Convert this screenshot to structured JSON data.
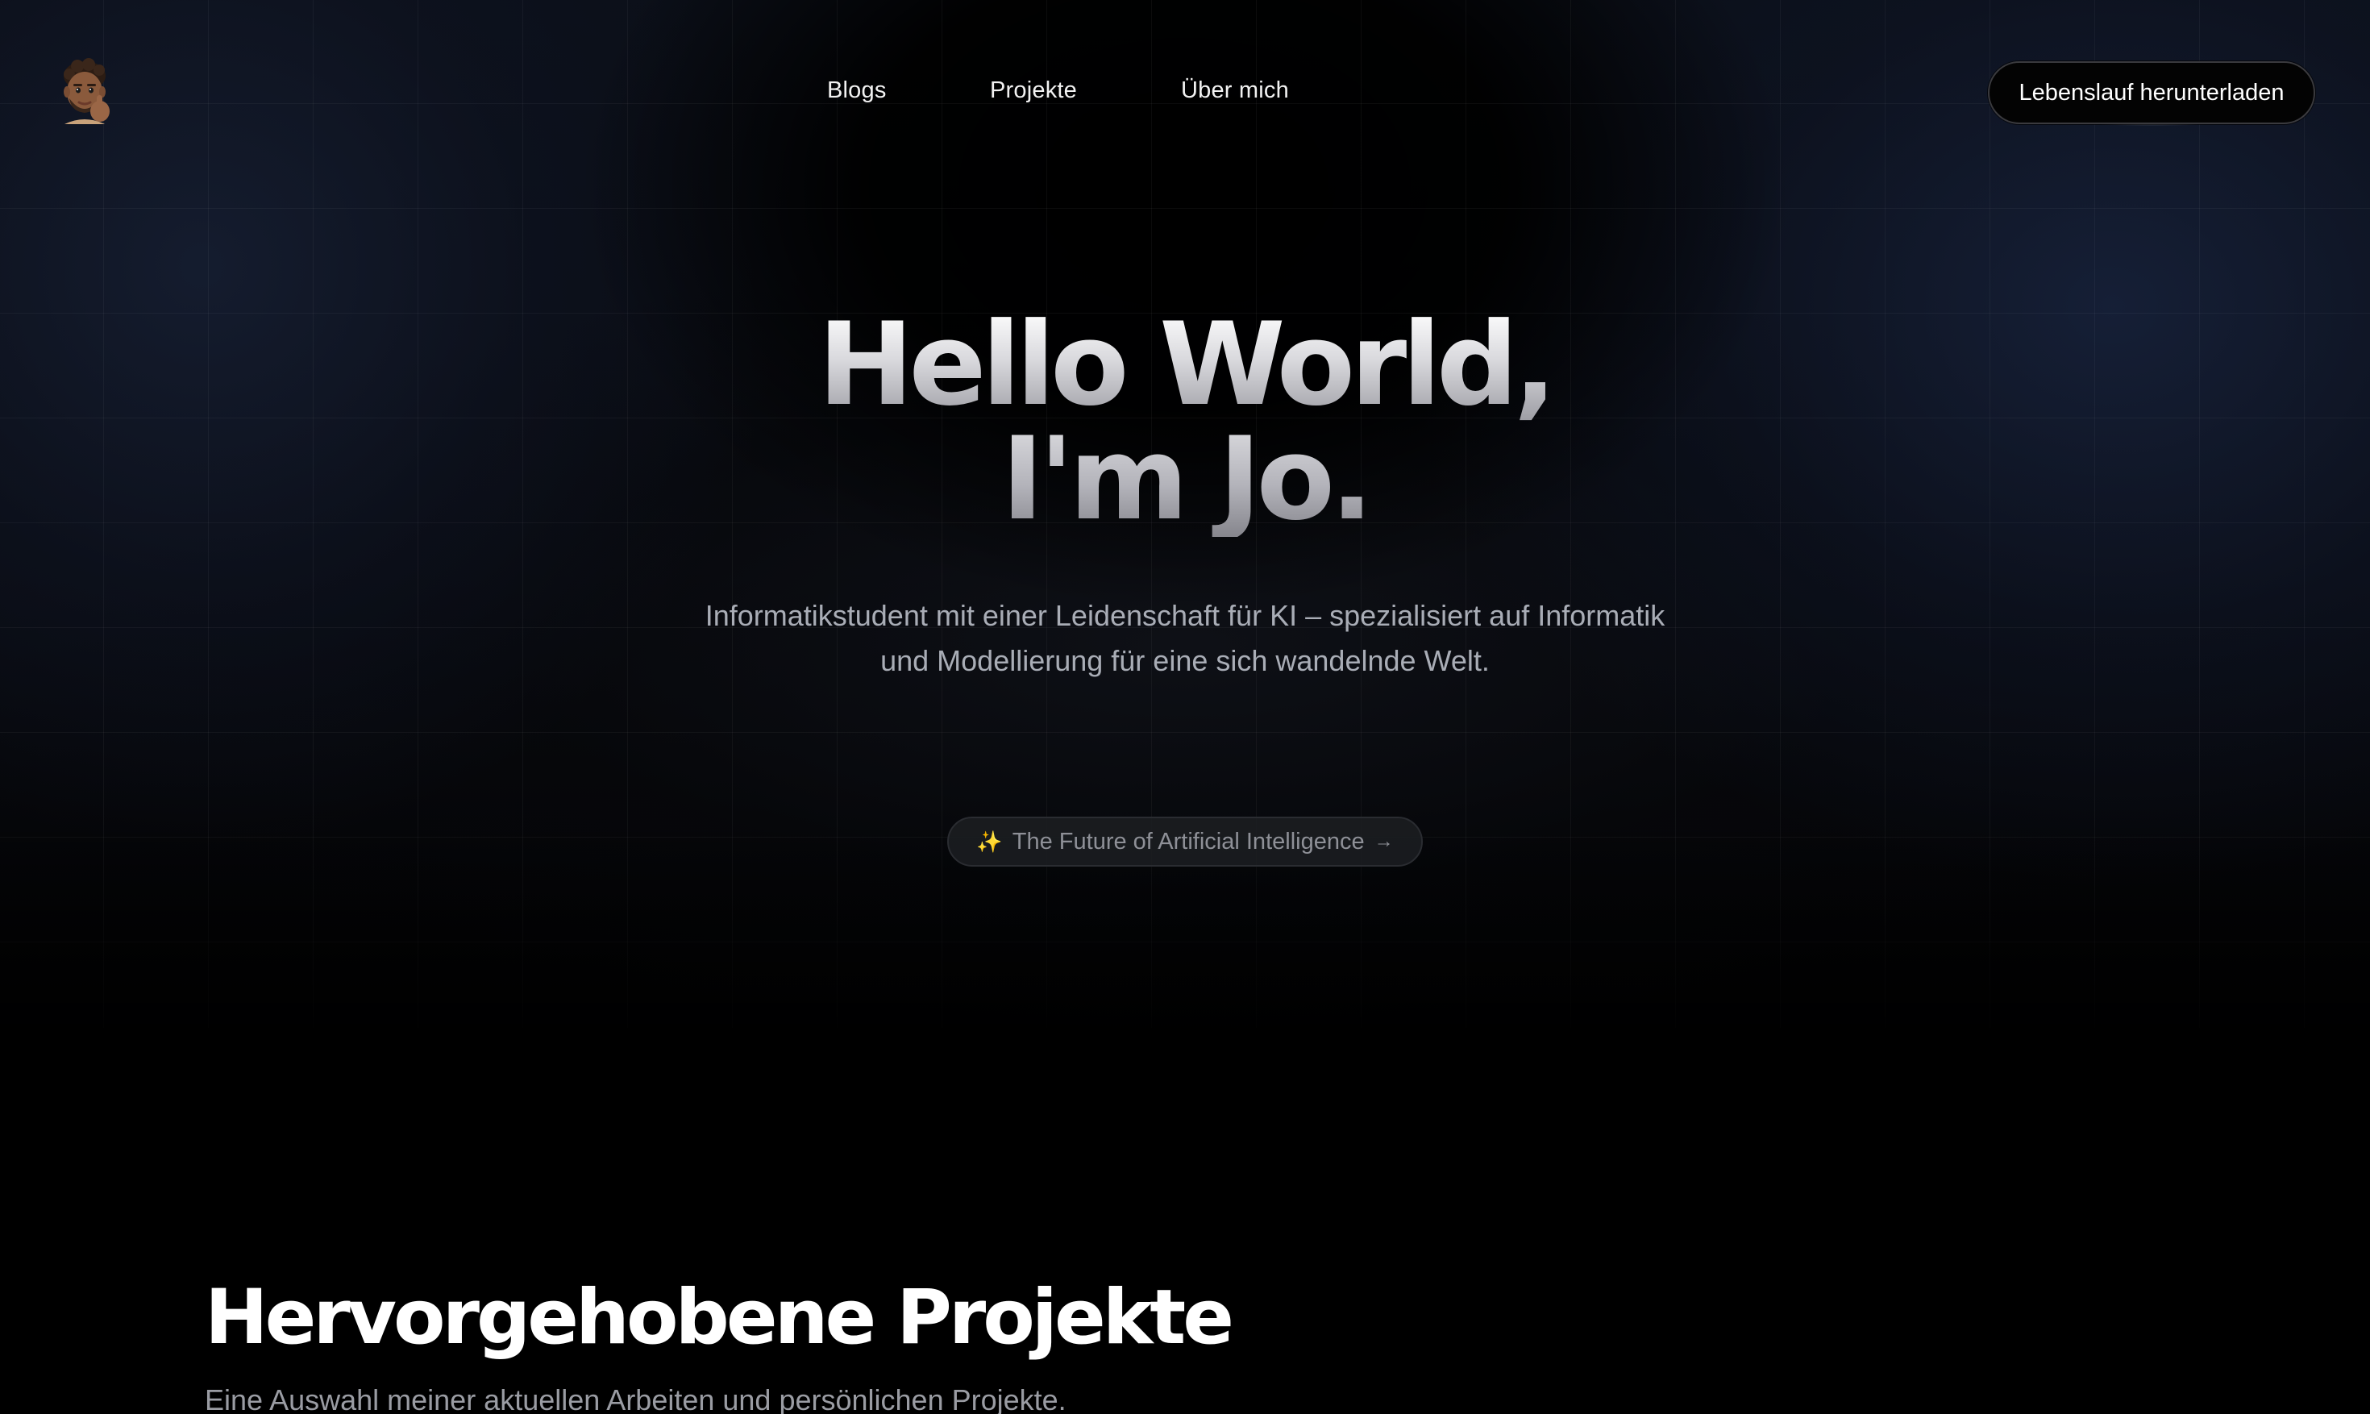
{
  "nav": {
    "logo_icon": "memoji-avatar-icon",
    "links": [
      {
        "label": "Blogs"
      },
      {
        "label": "Projekte"
      },
      {
        "label": "Über mich"
      }
    ],
    "cta_label": "Lebenslauf herunterladen"
  },
  "hero": {
    "title_line1": "Hello World,",
    "title_line2": "I'm Jo.",
    "subtitle": "Informatikstudent mit einer Leidenschaft für KI – spezialisiert auf Informatik und Modellierung für eine sich wandelnde Welt.",
    "pill": {
      "icon": "sparkles-icon",
      "icon_glyph": "✨",
      "label": "The Future of Artificial Intelligence",
      "arrow_glyph": "→"
    }
  },
  "projects": {
    "title": "Hervorgehobene Projekte",
    "subtitle": "Eine Auswahl meiner aktuellen Arbeiten und persönlichen Projekte."
  },
  "colors": {
    "background": "#000000",
    "grid_line": "rgba(255,255,255,0.045)",
    "glow_blue": "#162038",
    "text_primary": "#ffffff",
    "text_muted": "#a9adb6",
    "sparkle": "#f4d36b"
  }
}
